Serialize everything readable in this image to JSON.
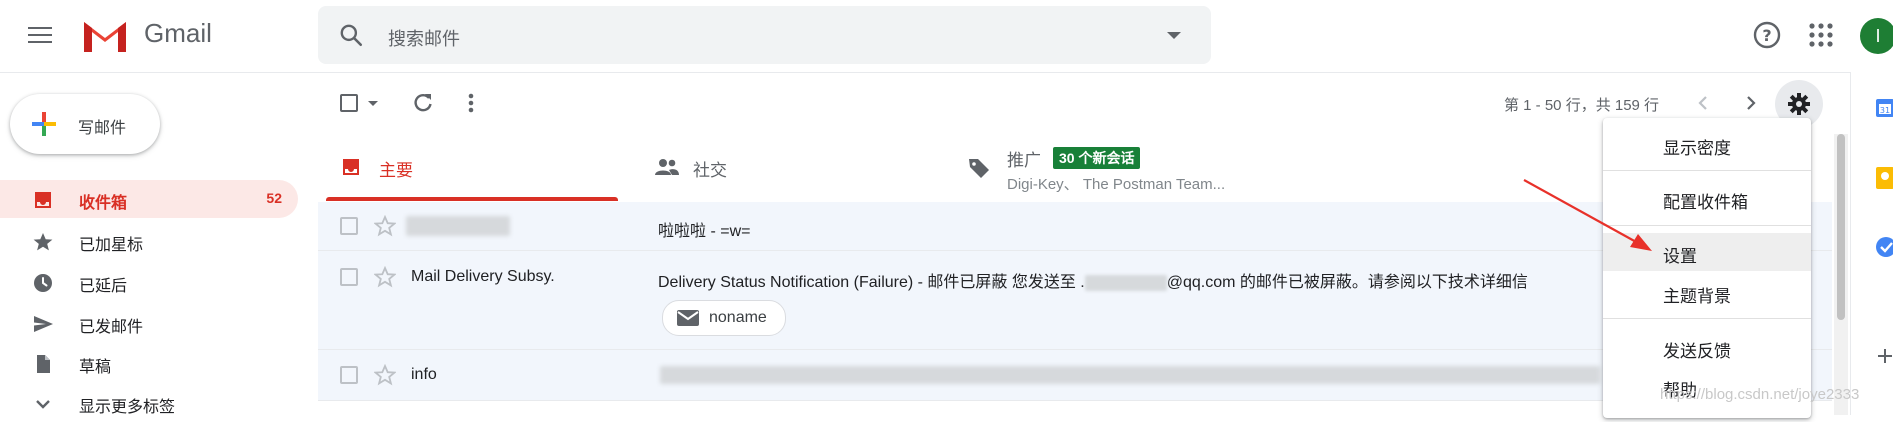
{
  "header": {
    "app_name": "Gmail",
    "search_placeholder": "搜索邮件",
    "avatar_letter": "I"
  },
  "compose": {
    "label": "写邮件"
  },
  "nav": {
    "items": [
      {
        "label": "收件箱",
        "count": "52",
        "icon": "inbox-icon",
        "active": true
      },
      {
        "label": "已加星标",
        "icon": "star-icon"
      },
      {
        "label": "已延后",
        "icon": "clock-icon"
      },
      {
        "label": "已发邮件",
        "icon": "send-icon"
      },
      {
        "label": "草稿",
        "icon": "draft-icon"
      },
      {
        "label": "显示更多标签",
        "icon": "chevron-down-icon"
      }
    ]
  },
  "toolbar": {
    "pagination": "第 1 - 50 行，共 159 行"
  },
  "tabs": [
    {
      "label": "主要",
      "icon": "inbox-icon",
      "active": true
    },
    {
      "label": "社交",
      "icon": "people-icon"
    },
    {
      "label": "推广",
      "icon": "tag-icon",
      "badge": "30 个新会话",
      "snippet": "Digi-Key、 The Postman Team..."
    }
  ],
  "messages": [
    {
      "sender": "",
      "subject": "啦啦啦 - =w="
    },
    {
      "sender": "Mail Delivery Subsy.",
      "subject_prefix": "Delivery Status Notification (Failure) - 邮件已屏蔽 您发送至 .",
      "subject_suffix": "@qq.com 的邮件已被屏蔽。请参阅以下技术详细信",
      "attachment": "noname"
    },
    {
      "sender": "info",
      "subject": ""
    }
  ],
  "settings_menu": {
    "items": [
      {
        "label": "显示密度"
      },
      {
        "label": "配置收件箱"
      },
      {
        "label": "设置",
        "highlighted": true
      },
      {
        "label": "主题背景"
      },
      {
        "label": "发送反馈"
      },
      {
        "label": "帮助"
      }
    ]
  },
  "watermark": "https://blog.csdn.net/joye2333",
  "colors": {
    "accent_red": "#d93025",
    "badge_green": "#188038",
    "avatar_green": "#1e7e34"
  }
}
